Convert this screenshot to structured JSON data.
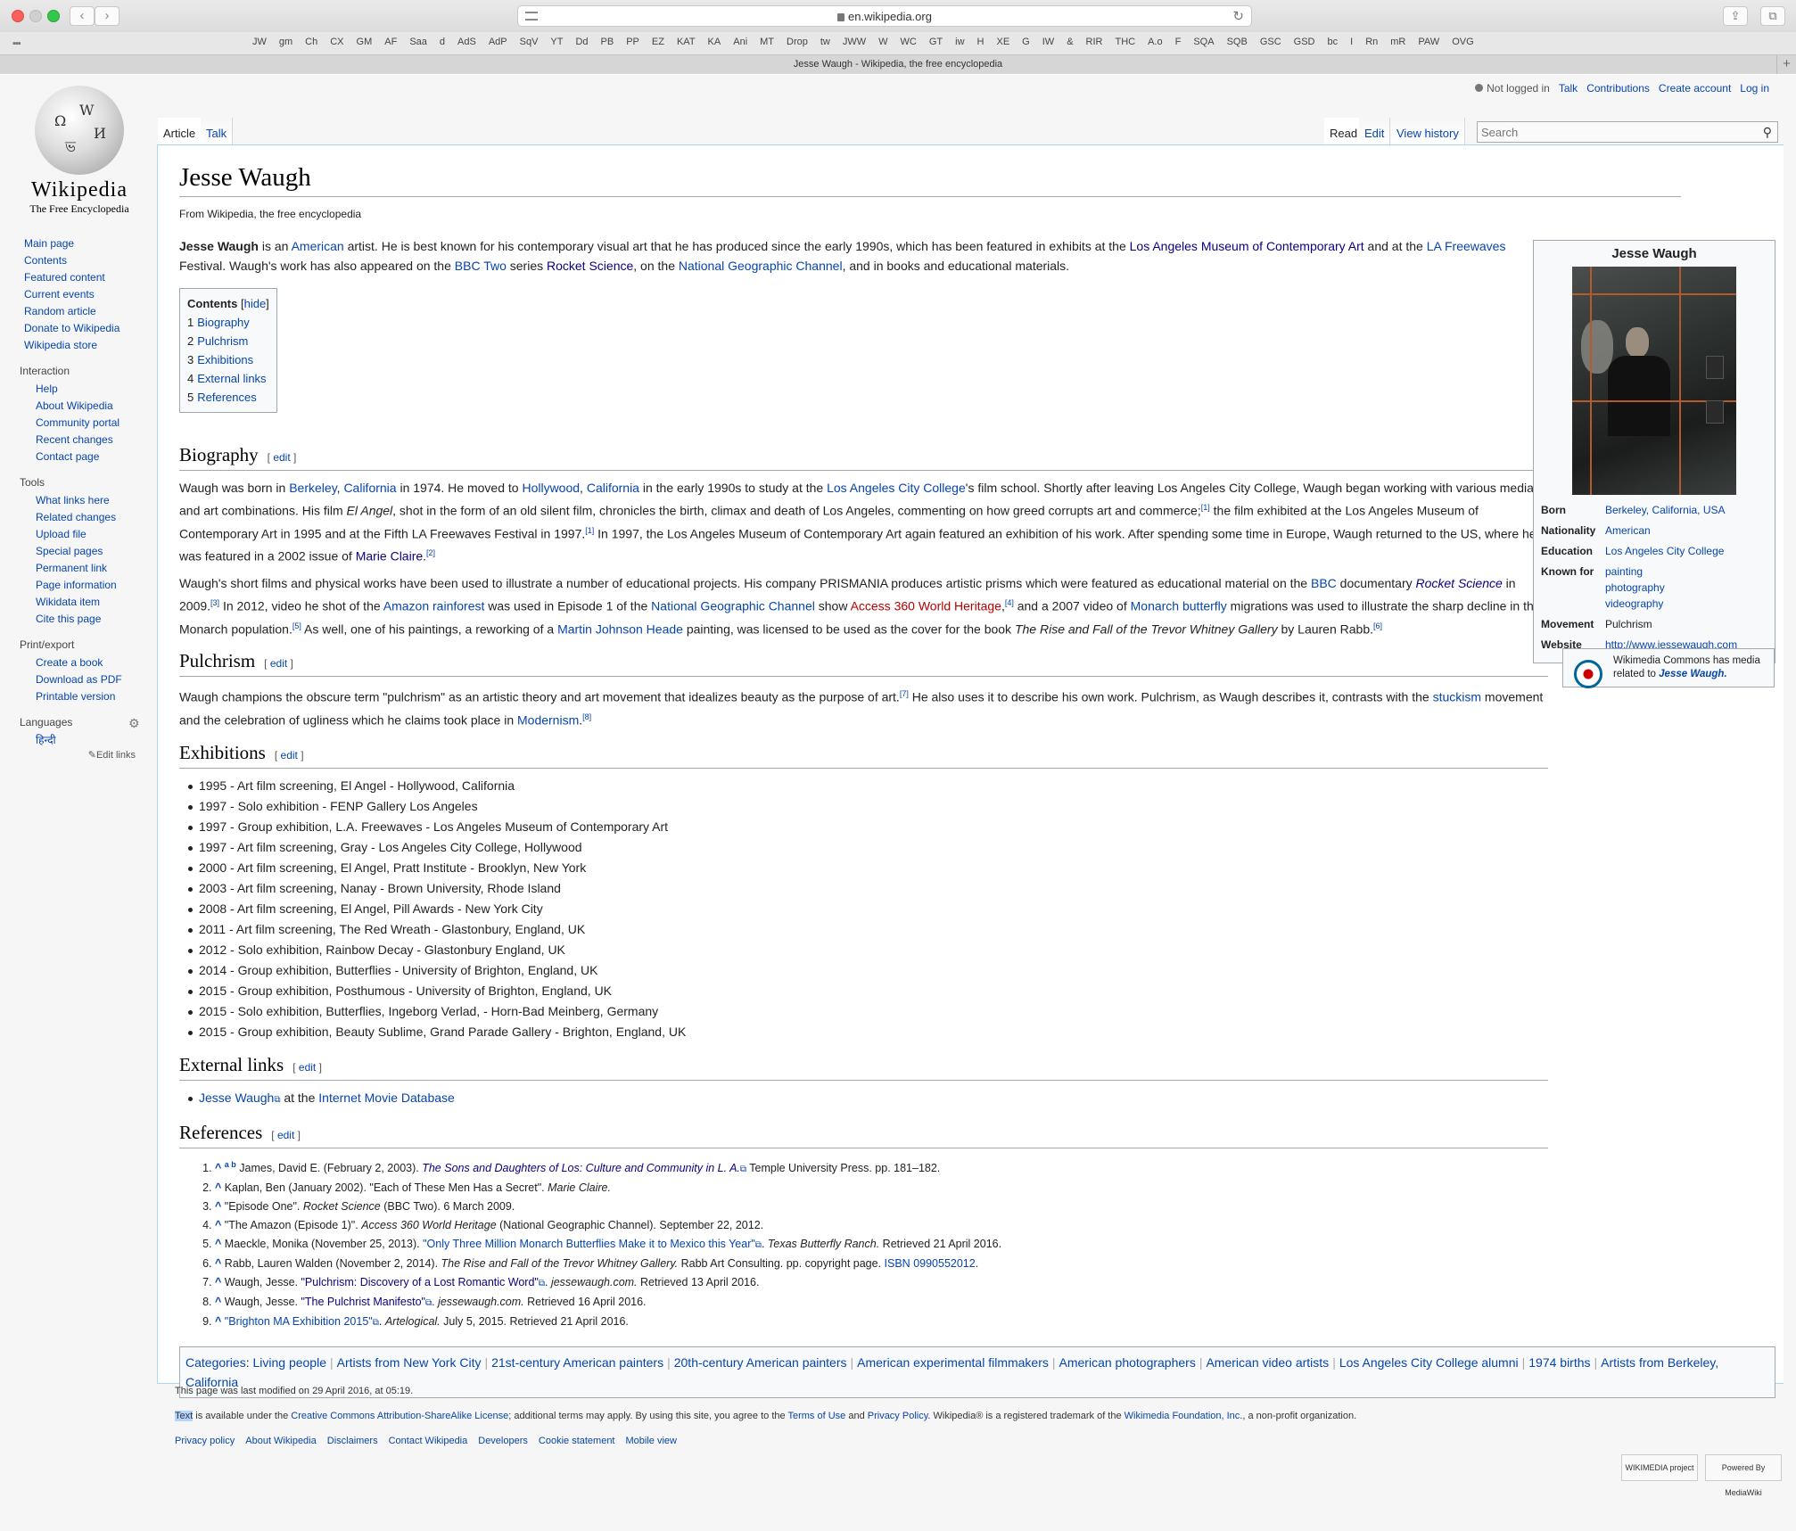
{
  "browser": {
    "url": "en.wikipedia.org",
    "tab_title": "Jesse Waugh - Wikipedia, the free encyclopedia",
    "bookmarks": [
      "JW",
      "gm",
      "Ch",
      "CX",
      "GM",
      "AF",
      "Saa",
      "d",
      "AdS",
      "AdP",
      "SqV",
      "YT",
      "Dd",
      "PB",
      "PP",
      "EZ",
      "KAT",
      "KA",
      "Ani",
      "MT",
      "Drop",
      "tw",
      "JWW",
      "W",
      "WC",
      "GT",
      "iw",
      "H",
      "XE",
      "G",
      "IW",
      "&",
      "RIR",
      "THC",
      "A.o",
      "F",
      "SQA",
      "SQB",
      "GSC",
      "GSD",
      "bc",
      "I",
      "Rn",
      "mR",
      "PAW",
      "OVG"
    ]
  },
  "logo": {
    "wordmark": "Wikipedia",
    "tagline": "The Free Encyclopedia"
  },
  "personal": {
    "not_logged_in": "Not logged in",
    "talk": "Talk",
    "contributions": "Contributions",
    "create_account": "Create account",
    "log_in": "Log in"
  },
  "tabs": {
    "article": "Article",
    "talk": "Talk",
    "read": "Read",
    "edit": "Edit",
    "history": "View history"
  },
  "search": {
    "placeholder": "Search"
  },
  "sidebar": {
    "main": [
      "Main page",
      "Contents",
      "Featured content",
      "Current events",
      "Random article",
      "Donate to Wikipedia",
      "Wikipedia store"
    ],
    "interaction_head": "Interaction",
    "interaction": [
      "Help",
      "About Wikipedia",
      "Community portal",
      "Recent changes",
      "Contact page"
    ],
    "tools_head": "Tools",
    "tools": [
      "What links here",
      "Related changes",
      "Upload file",
      "Special pages",
      "Permanent link",
      "Page information",
      "Wikidata item",
      "Cite this page"
    ],
    "print_head": "Print/export",
    "print": [
      "Create a book",
      "Download as PDF",
      "Printable version"
    ],
    "lang_head": "Languages",
    "lang": "हिन्दी",
    "edit_links": "Edit links"
  },
  "article": {
    "title": "Jesse Waugh",
    "from": "From Wikipedia, the free encyclopedia",
    "edit": "edit",
    "toc": {
      "title": "Contents",
      "hide": "hide",
      "items": [
        {
          "n": "1",
          "t": "Biography"
        },
        {
          "n": "2",
          "t": "Pulchrism"
        },
        {
          "n": "3",
          "t": "Exhibitions"
        },
        {
          "n": "4",
          "t": "External links"
        },
        {
          "n": "5",
          "t": "References"
        }
      ]
    },
    "sections": {
      "bio": "Biography",
      "pulchrism": "Pulchrism",
      "exhibitions": "Exhibitions",
      "external": "External links",
      "references": "References"
    },
    "exhibitions": [
      "1995 - Art film screening, El Angel - Hollywood, California",
      "1997 - Solo exhibition - FENP Gallery Los Angeles",
      "1997 - Group exhibition, L.A. Freewaves - Los Angeles Museum of Contemporary Art",
      "1997 - Art film screening, Gray - Los Angeles City College, Hollywood",
      "2000 - Art film screening, El Angel, Pratt Institute - Brooklyn, New York",
      "2003 - Art film screening, Nanay - Brown University, Rhode Island",
      "2008 - Art film screening, El Angel, Pill Awards - New York City",
      "2011 - Art film screening, The Red Wreath - Glastonbury, England, UK",
      "2012 - Solo exhibition, Rainbow Decay - Glastonbury England, UK",
      "2014 - Group exhibition, Butterflies - University of Brighton, England, UK",
      "2015 - Group exhibition, Posthumous - University of Brighton, England, UK",
      "2015 - Solo exhibition, Butterflies, Ingeborg Verlad, - Horn-Bad Meinberg, Germany",
      "2015 - Group exhibition, Beauty Sublime, Grand Parade Gallery - Brighton, England, UK"
    ],
    "external_link": {
      "link": "Jesse Waugh",
      "rest": " at the ",
      "db": "Internet Movie Database"
    },
    "categories_label": "Categories",
    "categories": [
      "Living people",
      "Artists from New York City",
      "21st-century American painters",
      "20th-century American painters",
      "American experimental filmmakers",
      "American photographers",
      "American video artists",
      "Los Angeles City College alumni",
      "1974 births",
      "Artists from Berkeley, California"
    ]
  },
  "infobox": {
    "title": "Jesse Waugh",
    "rows": [
      {
        "label": "Born",
        "value": "Berkeley, California, USA"
      },
      {
        "label": "Nationality",
        "value": "American"
      },
      {
        "label": "Education",
        "value": "Los Angeles City College"
      },
      {
        "label": "Known for",
        "value": "painting\nphotography\nvideography"
      },
      {
        "label": "Movement",
        "value": "Pulchrism"
      },
      {
        "label": "Website",
        "value": "http://www.jessewaugh.com"
      }
    ]
  },
  "commons": {
    "text": "Wikimedia Commons has media related to",
    "subject": "Jesse Waugh."
  },
  "footer": {
    "modified": "This page was last modified on 29 April 2016, at 05:19.",
    "links": [
      "Privacy policy",
      "About Wikipedia",
      "Disclaimers",
      "Contact Wikipedia",
      "Developers",
      "Cookie statement",
      "Mobile view"
    ],
    "badge1": "WIKIMEDIA project",
    "badge2": "Powered By MediaWiki"
  }
}
